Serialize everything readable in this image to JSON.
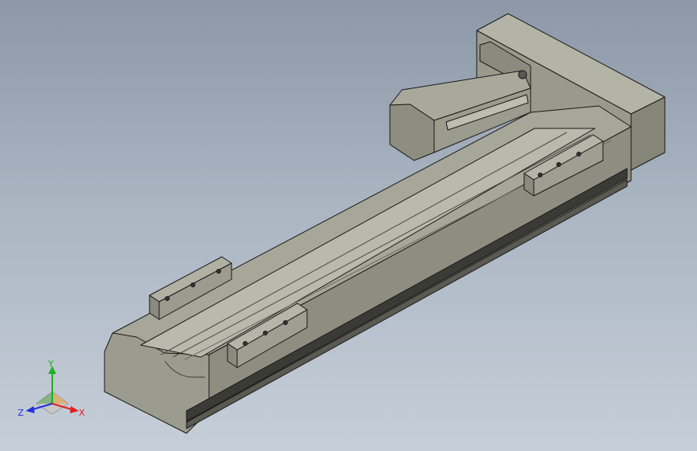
{
  "viewport": {
    "background_top": "#8c98a8",
    "background_bottom": "#c6ced8"
  },
  "model": {
    "body_color": "#9c9c8e",
    "top_color": "#a7a799",
    "dark_color": "#5a5a52",
    "edge_color": "#1a1a1a"
  },
  "triad": {
    "x_label": "X",
    "y_label": "Y",
    "z_label": "Z",
    "x_color": "#e02020",
    "y_color": "#20b020",
    "z_color": "#2030e0"
  }
}
